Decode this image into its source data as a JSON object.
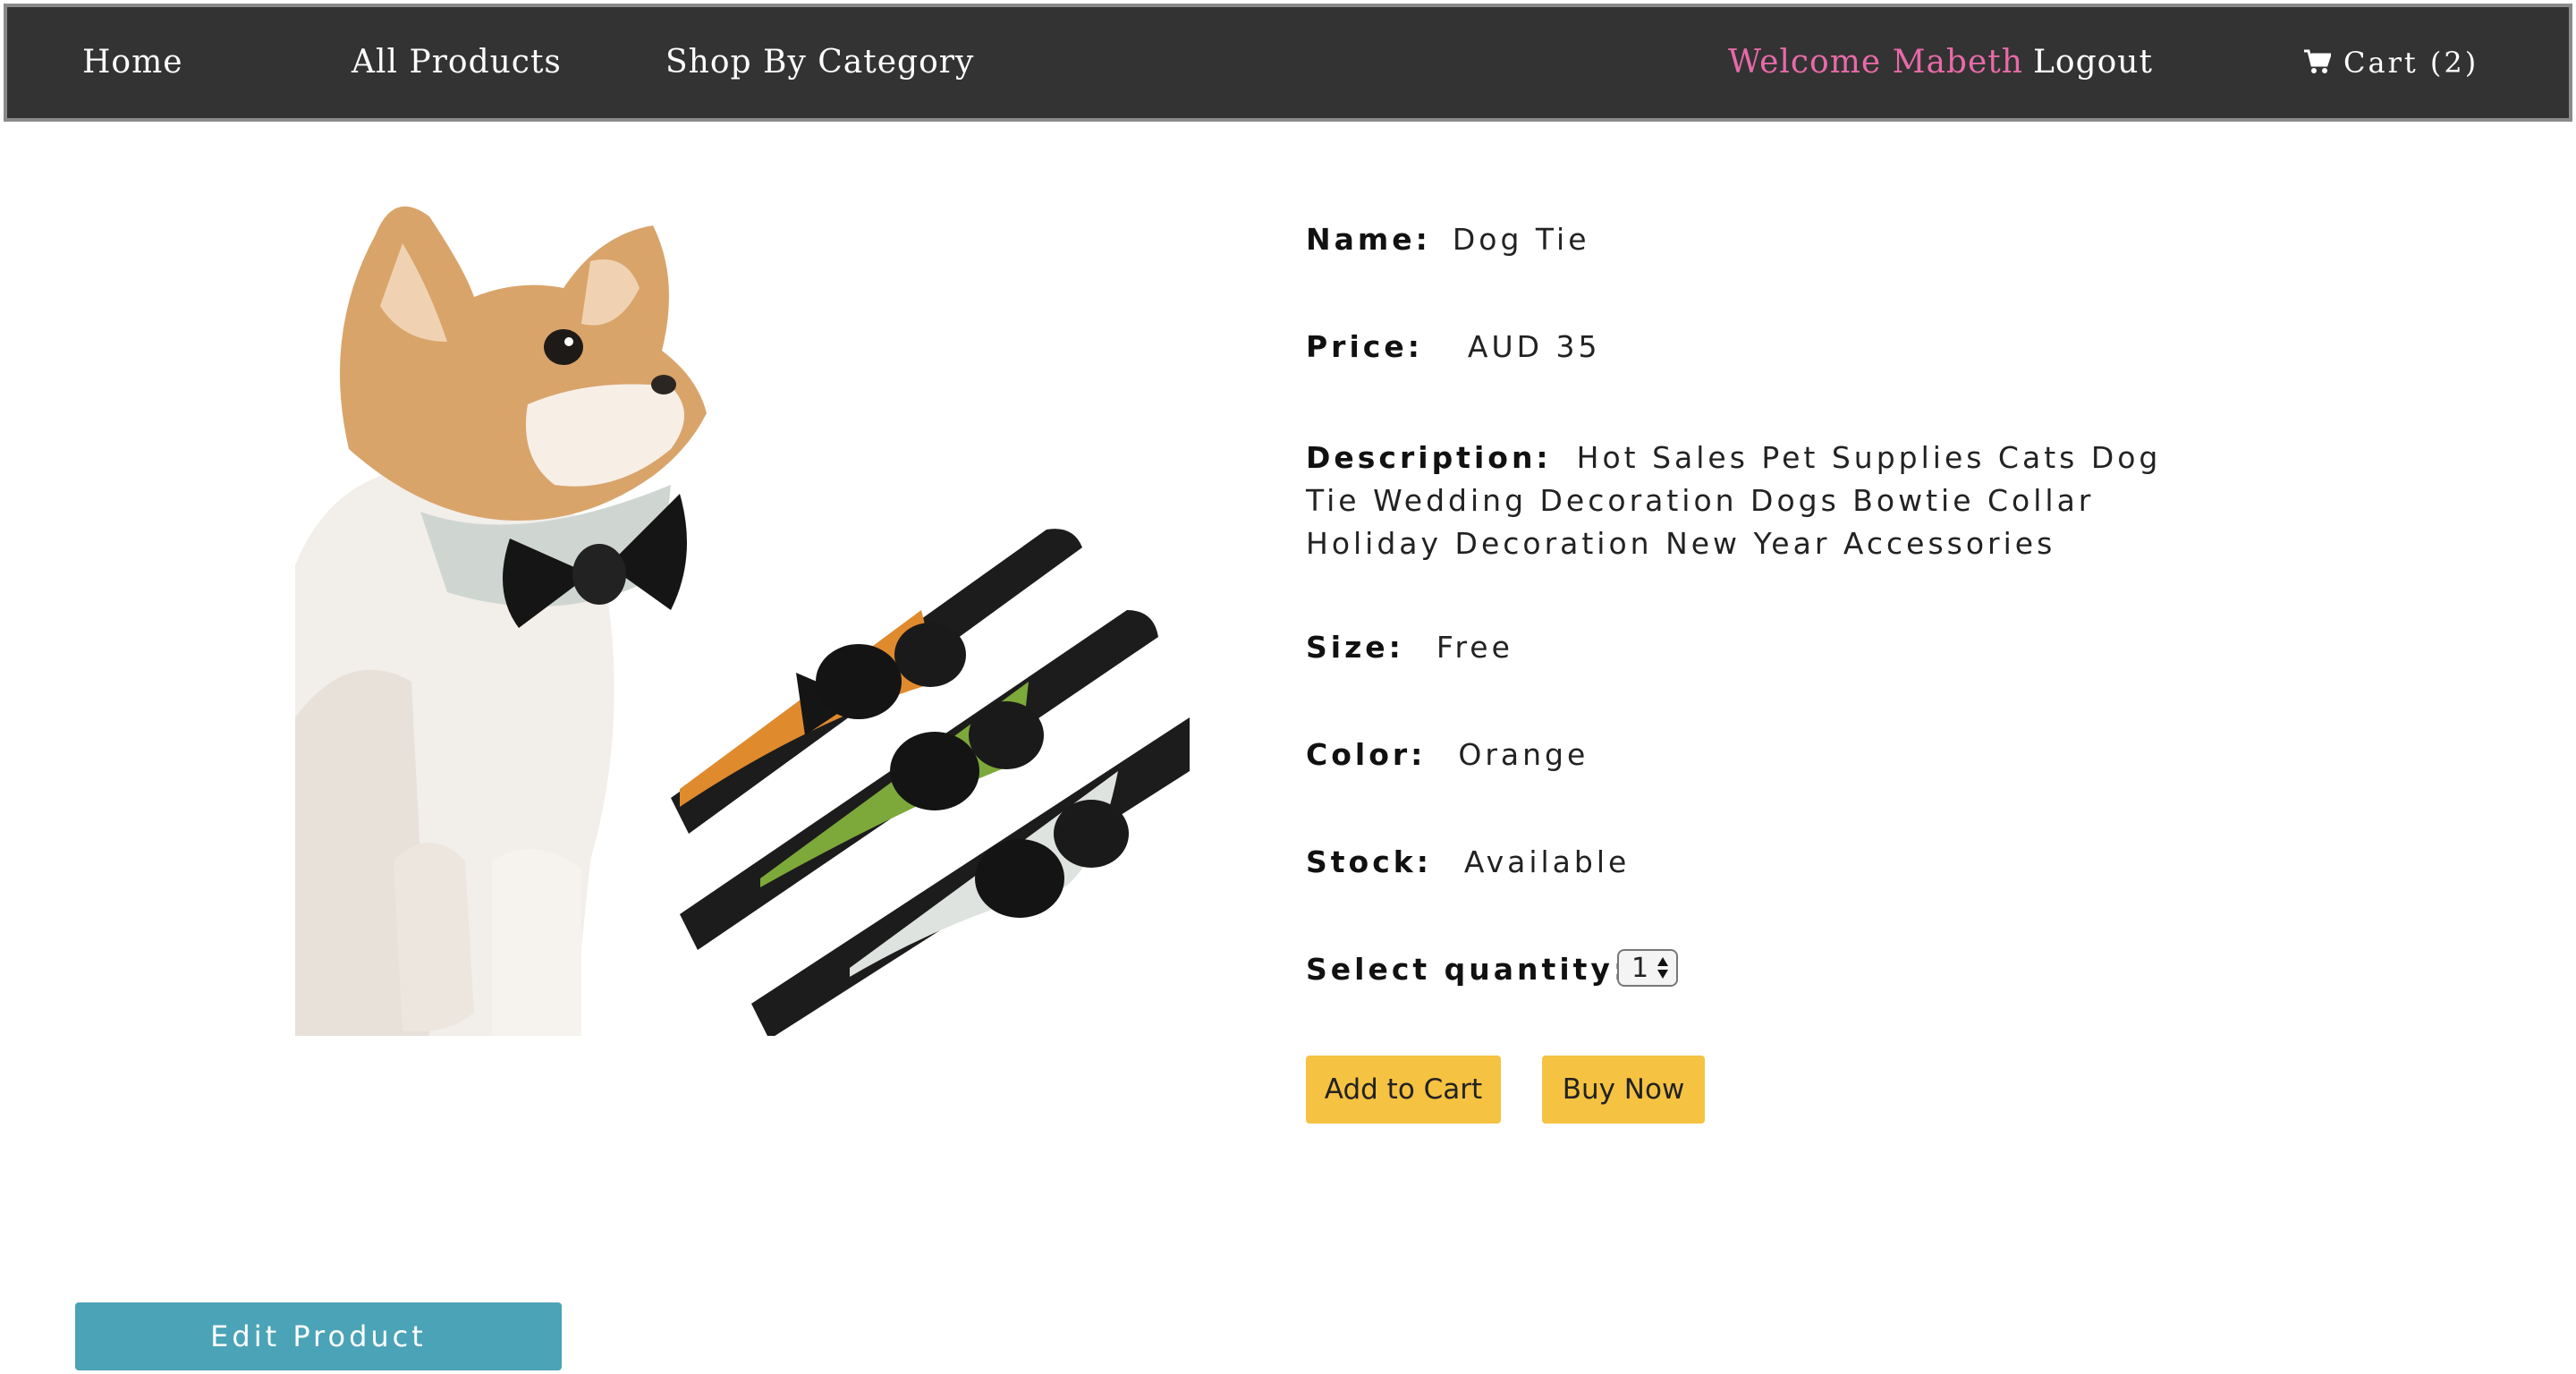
{
  "nav": {
    "home": "Home",
    "all_products": "All Products",
    "shop_by_category": "Shop By Category",
    "welcome": "Welcome Mabeth",
    "logout": "Logout",
    "cart": "Cart (2)",
    "cart_icon": "shopping-cart-icon",
    "welcome_color": "#e86aa8",
    "bar_color": "#333333"
  },
  "product": {
    "image_alt": "Chihuahua wearing a black bow tie collar with orange, green and white bow tie collars",
    "name_label": "Name:",
    "name": "Dog Tie",
    "price_label": "Price:",
    "price": "AUD 35",
    "description_label": "Description:",
    "description": "Hot Sales Pet Supplies Cats Dog Tie Wedding Decoration Dogs Bowtie Collar Holiday Decoration New Year Accessories",
    "size_label": "Size:",
    "size": "Free",
    "color_label": "Color:",
    "color": "Orange",
    "stock_label": "Stock:",
    "stock": "Available",
    "quantity_label": "Select quantity:",
    "quantity": "1"
  },
  "actions": {
    "add_to_cart": "Add to Cart",
    "buy_now": "Buy Now",
    "edit_product": "Edit Product",
    "button_color": "#f5c242",
    "edit_color": "#4ba3b7"
  }
}
